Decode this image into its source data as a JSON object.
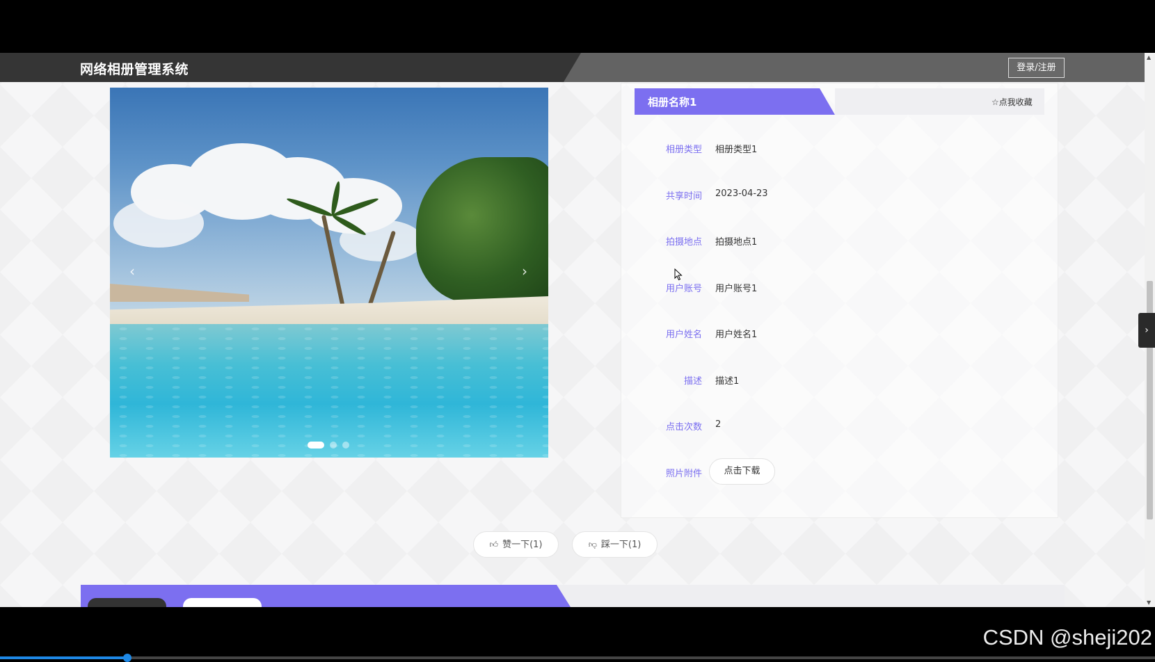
{
  "header": {
    "site_title": "网络相册管理系统",
    "login_label": "登录/注册"
  },
  "carousel": {
    "prev_icon": "‹",
    "next_icon": "›",
    "slide_count": 3,
    "active_index": 0
  },
  "album": {
    "name": "相册名称1",
    "favorite_label": "☆点我收藏",
    "fields": [
      {
        "label": "相册类型",
        "value": "相册类型1"
      },
      {
        "label": "共享时间",
        "value": "2023-04-23"
      },
      {
        "label": "拍摄地点",
        "value": "拍摄地点1"
      },
      {
        "label": "用户账号",
        "value": "用户账号1"
      },
      {
        "label": "用户姓名",
        "value": "用户姓名1"
      },
      {
        "label": "描述",
        "value": "描述1"
      },
      {
        "label": "点击次数",
        "value": "2"
      },
      {
        "label": "照片附件",
        "value": ""
      }
    ],
    "download_label": "点击下载"
  },
  "votes": {
    "like_label": "赞一下(1)",
    "dislike_label": "踩一下(1)",
    "like_icon": "thumbs-up-icon",
    "dislike_icon": "thumbs-down-icon"
  },
  "side_toggle_icon": "›",
  "watermark": "CSDN @sheji202",
  "video_progress": 0.11,
  "colors": {
    "accent": "#7c6ff0",
    "header_dark": "#353535",
    "header_light": "#636363",
    "label": "#7a6ef0"
  }
}
